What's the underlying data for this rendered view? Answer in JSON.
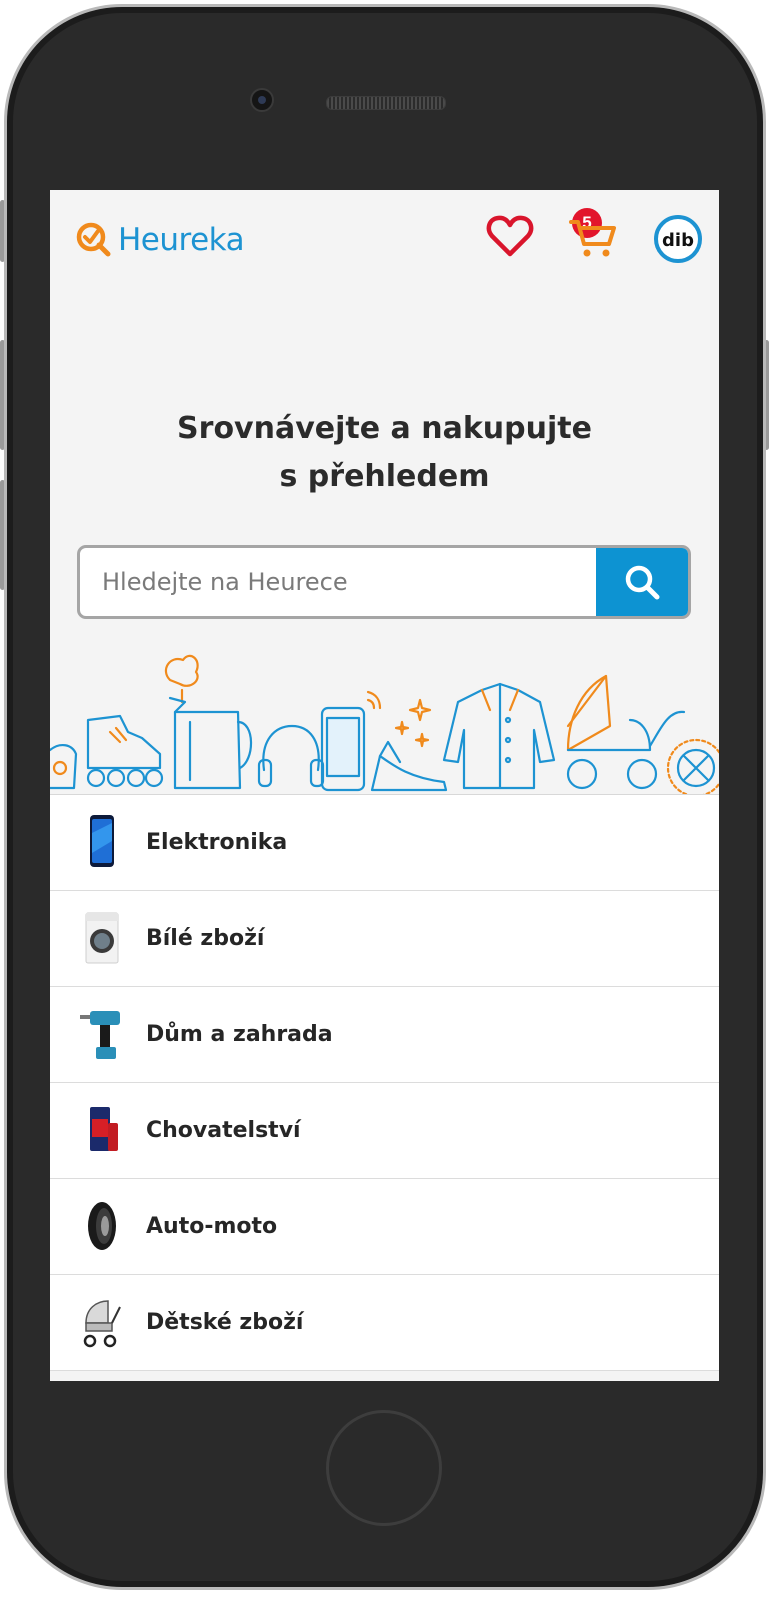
{
  "header": {
    "logo_text": "Heureka",
    "wishlist_count": "5",
    "avatar_initials": "dib"
  },
  "hero": {
    "title_line1": "Srovnávejte a nakupujte",
    "title_line2": "s přehledem"
  },
  "search": {
    "placeholder": "Hledejte na Heurece"
  },
  "categories": [
    {
      "label": "Elektronika",
      "icon": "smartphone-icon"
    },
    {
      "label": "Bílé zboží",
      "icon": "washing-machine-icon"
    },
    {
      "label": "Dům a zahrada",
      "icon": "drill-icon"
    },
    {
      "label": "Chovatelství",
      "icon": "pet-food-bag-icon"
    },
    {
      "label": "Auto-moto",
      "icon": "tire-icon"
    },
    {
      "label": "Dětské zboží",
      "icon": "stroller-icon"
    }
  ],
  "colors": {
    "brand_blue": "#1d93d2",
    "brand_orange": "#f08a1c",
    "badge_red": "#e2152c",
    "search_button": "#0d93d2"
  }
}
